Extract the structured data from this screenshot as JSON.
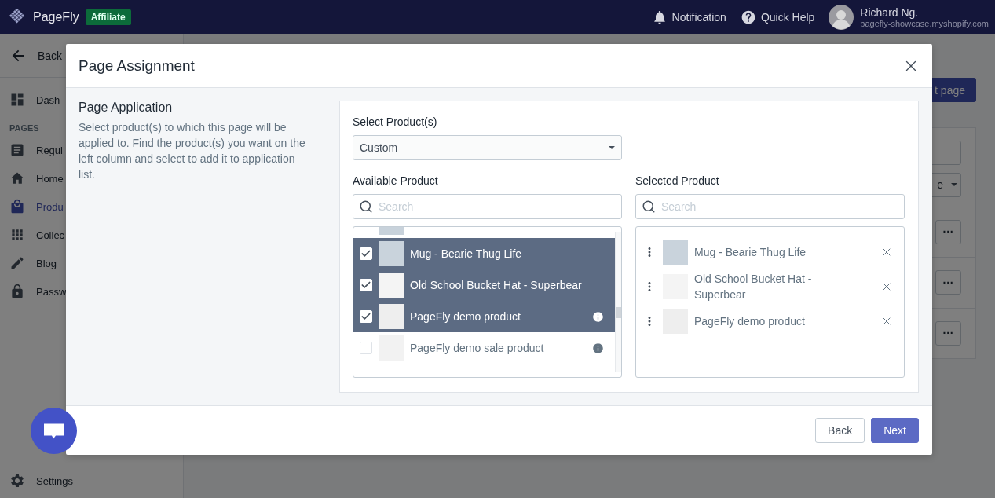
{
  "topbar": {
    "logo": "PageFly",
    "badge": "Affiliate",
    "links": [
      {
        "label": "Notification"
      },
      {
        "label": "Quick Help"
      }
    ],
    "user": {
      "name": "Richard Ng.",
      "shop": "pagefly-showcase.myshopify.com"
    }
  },
  "sidebar": {
    "back": "Back",
    "items": [
      {
        "label": "Dash",
        "selected": false
      }
    ],
    "section": "PAGES",
    "pages": [
      {
        "label": "Regul",
        "selected": false
      },
      {
        "label": "Home",
        "selected": false
      },
      {
        "label": "Produ",
        "selected": true
      },
      {
        "label": "Collec",
        "selected": false
      },
      {
        "label": "Blog",
        "selected": false
      },
      {
        "label": "Passw",
        "selected": false
      }
    ],
    "footer": "Settings"
  },
  "content": {
    "button": "t page",
    "filter": "e",
    "row_menus": [
      "···",
      "···",
      "···"
    ]
  },
  "modal": {
    "title": "Page Assignment",
    "section_title": "Page Application",
    "description": "Select product(s) to which this page will be applied to. Find the product(s) you want on the left column and select to add it to application list.",
    "select_label": "Select Product(s)",
    "select_value": "Custom",
    "available": {
      "label": "Available Product",
      "placeholder": "Search",
      "items": [
        {
          "name": "Mug - Bearie Thug Life",
          "checked": true,
          "info": false
        },
        {
          "name": "Old School Bucket Hat - Superbear",
          "checked": true,
          "info": false
        },
        {
          "name": "PageFly demo product",
          "checked": true,
          "info": true
        },
        {
          "name": "PageFly demo sale product",
          "checked": false,
          "info": true
        }
      ]
    },
    "selected": {
      "label": "Selected Product",
      "placeholder": "Search",
      "items": [
        {
          "name": "Mug - Bearie Thug Life"
        },
        {
          "name": "Old School Bucket Hat - Superbear"
        },
        {
          "name": "PageFly demo product"
        }
      ]
    },
    "buttons": {
      "back": "Back",
      "next": "Next"
    }
  }
}
